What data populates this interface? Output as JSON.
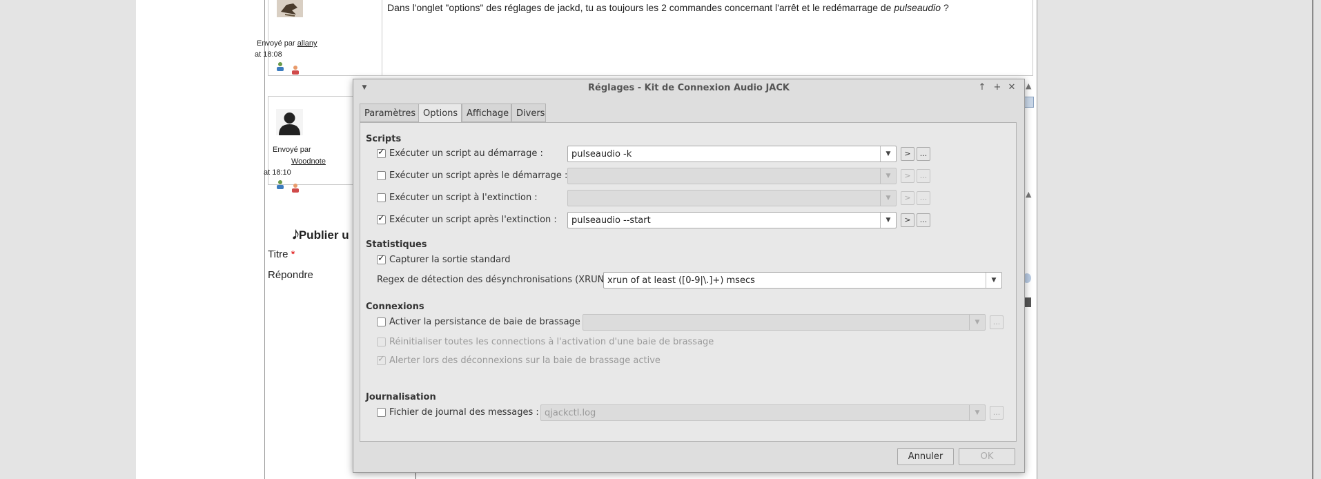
{
  "post1": {
    "text_before": "Dans l'onglet \"options\" des réglages de jackd, tu as toujours les 2 commandes concernant l'arrêt et le redémarrage de ",
    "text_italic": "pulseaudio",
    "text_after": " ?",
    "sent_by": "Envoyé par",
    "author": "allany",
    "time": "at 18:08"
  },
  "post2": {
    "sent_by": "Envoyé par",
    "author": "Woodnote",
    "time": "at 18:10"
  },
  "reply": {
    "heading": "Publier u",
    "title_label": "Titre",
    "required_mark": "*",
    "reply_label": "Répondre"
  },
  "dialog": {
    "title": "Réglages - Kit de Connexion Audio JACK",
    "tabs": [
      "Paramètres",
      "Options",
      "Affichage",
      "Divers"
    ],
    "active_tab": "Options",
    "scripts": {
      "heading": "Scripts",
      "rows": [
        {
          "label": "Exécuter un script au démarrage :",
          "checked": true,
          "value": "pulseaudio -k",
          "enabled": true
        },
        {
          "label": "Exécuter un script après le démarrage :",
          "checked": false,
          "value": "",
          "enabled": false
        },
        {
          "label": "Exécuter un script à l'extinction :",
          "checked": false,
          "value": "",
          "enabled": false
        },
        {
          "label": "Exécuter un script après l'extinction :",
          "checked": true,
          "value": "pulseaudio --start",
          "enabled": true
        }
      ],
      "run_button": ">",
      "browse_button": "..."
    },
    "stats": {
      "heading": "Statistiques",
      "capture_label": "Capturer la sortie standard",
      "capture_checked": true,
      "xrun_label": "Regex de détection des désynchronisations (XRUN) :",
      "xrun_value": "xrun of at least ([0-9|\\.]+) msecs"
    },
    "connections": {
      "heading": "Connexions",
      "persist_label": "Activer la persistance de baie de brassage :",
      "persist_checked": false,
      "reset_label": "Réinitialiser toutes les connections à l'activation d'une baie de brassage",
      "reset_checked": false,
      "alert_label": "Alerter lors des déconnexions sur la baie de brassage active",
      "alert_checked": true
    },
    "logging": {
      "heading": "Journalisation",
      "log_label": "Fichier de journal des messages :",
      "log_checked": false,
      "log_value": "qjackctl.log"
    },
    "cancel_label": "Annuler",
    "ok_label": "OK"
  }
}
